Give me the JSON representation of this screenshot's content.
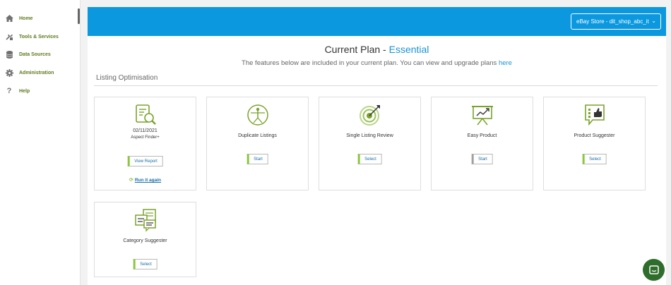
{
  "sidebar": {
    "items": [
      {
        "label": "Home",
        "icon": "home-icon"
      },
      {
        "label": "Tools & Services",
        "icon": "wrench-icon"
      },
      {
        "label": "Data Sources",
        "icon": "database-icon"
      },
      {
        "label": "Administration",
        "icon": "gear-icon"
      },
      {
        "label": "Help",
        "icon": "question-icon"
      }
    ]
  },
  "header": {
    "store_select": "eBay Store - dit_shop_abc_it"
  },
  "plan": {
    "title_prefix": "Current Plan - ",
    "plan_name": "Essential",
    "subtitle": "The features below are included in your current plan. You can view and upgrade plans ",
    "link_text": "here"
  },
  "section": {
    "title": "Listing Optimisation"
  },
  "cards": [
    {
      "date": "02/11/2021",
      "subtitle": "Aspect Finder+",
      "button": "View Report",
      "link": "Run it again",
      "icon": "report-search-icon"
    },
    {
      "title": "Duplicate Listings",
      "button": "Start",
      "icon": "vitruvian-icon"
    },
    {
      "title": "Single Listing Review",
      "button": "Select",
      "icon": "target-icon"
    },
    {
      "title": "Easy Product",
      "button": "Start",
      "icon": "presentation-icon"
    },
    {
      "title": "Product Suggester",
      "button": "Select",
      "icon": "thumbs-up-checklist-icon"
    },
    {
      "title": "Category Suggester",
      "button": "Select",
      "icon": "documents-chat-icon"
    }
  ],
  "colors": {
    "banner": "#0b98de",
    "accent_green": "#8cc63f",
    "nav_text": "#5f7a1f",
    "link_blue": "#1a94d6",
    "chat": "#2f6d2c"
  }
}
